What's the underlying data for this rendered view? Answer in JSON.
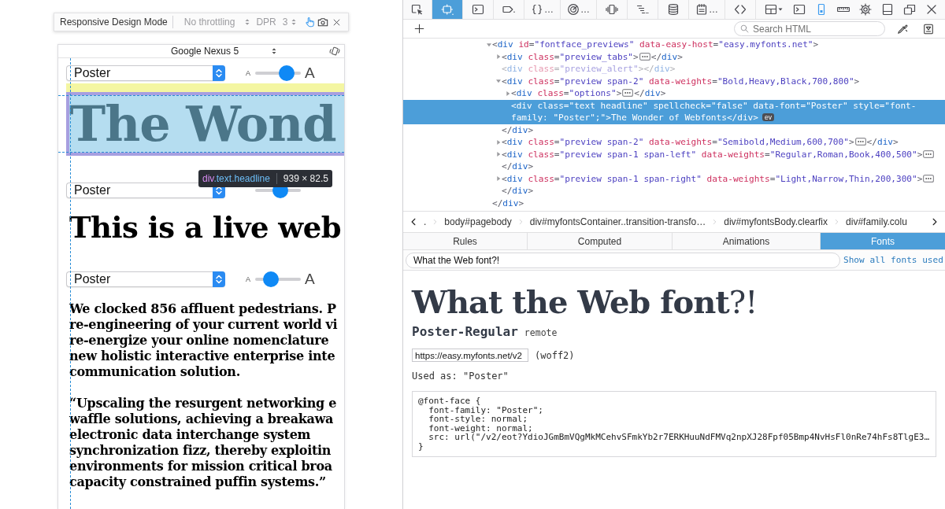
{
  "responsive_mode": {
    "toolbar": {
      "title": "Responsive Design Mode",
      "throttling": "No throttling",
      "dpr_label": "DPR",
      "dpr": "3",
      "touch_simulation": true
    },
    "viewport": {
      "device": "Google Nexus 5",
      "previews": [
        {
          "kind": "headline",
          "font": "Poster",
          "small_label": "A",
          "large_label": "A",
          "level": 0.79,
          "highlighted": true,
          "text": "The Wond"
        },
        {
          "kind": "title",
          "font": "Poster",
          "level": 0.58,
          "highlighted": false,
          "text": "This is a live web"
        },
        {
          "kind": "body",
          "font": "Poster",
          "small_label": "A",
          "large_label": "A",
          "level": 0.26,
          "highlighted": false,
          "paragraphs": [
            [
              "We clocked 856 affluent pedestrians. P",
              "re-engineering of your current world vi",
              "re-energize your online nomenclature",
              "new holistic interactive enterprise inte",
              "communication solution."
            ],
            [
              "“Upscaling the resurgent networking e",
              "waffle solutions, achieving a breakawa",
              "electronic data interchange system",
              "synchronization fizz, thereby exploitin",
              "environments for mission critical broa",
              "capacity constrained puffin systems.”"
            ]
          ]
        }
      ],
      "infobar": {
        "selector": "div.text.headline",
        "size": "939 × 82.5"
      }
    }
  },
  "devtools": {
    "tool_tabs": [
      {
        "selected": false
      },
      {
        "selected": true
      },
      {
        "selected": false
      },
      {
        "selected": false
      },
      {
        "selected": false,
        "label": "…"
      },
      {
        "selected": false,
        "label": "…"
      },
      {
        "selected": false
      },
      {
        "selected": false
      },
      {
        "selected": false
      },
      {
        "selected": false,
        "label": "…"
      },
      {
        "selected": false
      }
    ],
    "toolbar_buttons": [
      {
        "on": false
      },
      {
        "on": false
      },
      {
        "on": true
      },
      {
        "on": false
      },
      {
        "on": false
      },
      {
        "on": false
      },
      {
        "on": false
      },
      {
        "on": false
      }
    ],
    "search": {
      "placeholder": "Search HTML"
    },
    "markup": {
      "nodes": [
        {
          "kind": "container",
          "open_tag": "<div id=\"fontface_previews\" data-easy-host=\"easy.myfonts.net\">",
          "close_tag": "</div>",
          "expanded": true,
          "hidden": false,
          "selected": false,
          "children": [
            {
              "kind": "container",
              "open_tag": "<div class=\"preview_tabs\">",
              "close_tag": "</div>",
              "expanded": false,
              "hidden": false,
              "selected": false
            },
            {
              "kind": "leaf",
              "open_tag": "<div class=\"preview_alert\">",
              "close_tag": "</div>",
              "hidden": true,
              "selected": false
            },
            {
              "kind": "container",
              "open_tag": "<div class=\"preview span-2\" data-weights=\"Bold,Heavy,Black,700,800\">",
              "close_tag": "</div>",
              "expanded": true,
              "hidden": false,
              "selected": false,
              "children": [
                {
                  "kind": "container",
                  "open_tag": "<div class=\"options\">",
                  "close_tag": "</div>",
                  "expanded": false,
                  "hidden": false,
                  "selected": false
                },
                {
                  "kind": "leaf",
                  "open_tag": "<div class=\"text headline\" spellcheck=\"false\" data-font=\"Poster\" style=\"font-family: \"Poster\";\">",
                  "text": "The Wonder of Webfonts",
                  "close_tag": "</div>",
                  "badge": "ev",
                  "hidden": false,
                  "selected": true
                }
              ]
            },
            {
              "kind": "container",
              "open_tag": "<div class=\"preview span-2\" data-weights=\"Semibold,Medium,600,700\">",
              "close_tag": "</div>",
              "expanded": false,
              "hidden": false,
              "selected": false
            },
            {
              "kind": "container",
              "open_tag": "<div class=\"preview span-1 span-left\" data-weights=\"Regular,Roman,Book,400,500\">",
              "close_tag": "</div>",
              "expanded": false,
              "hidden": false,
              "selected": false
            },
            {
              "kind": "container",
              "open_tag": "<div class=\"preview span-1 span-right\" data-weights=\"Light,Narrow,Thin,200,300\">",
              "close_tag": "</div>",
              "expanded": false,
              "hidden": false,
              "selected": false
            }
          ]
        }
      ]
    },
    "breadcrumbs": [
      ".",
      "body#pagebody",
      "div#myfontsContainer..transition-transfo…",
      "div#myfontsBody.clearfix",
      "div#family.colu"
    ],
    "sidebar_tabs": [
      {
        "label": "Rules",
        "selected": false
      },
      {
        "label": "Computed",
        "selected": false
      },
      {
        "label": "Animations",
        "selected": false
      },
      {
        "label": "Fonts",
        "selected": true
      }
    ],
    "fonts": {
      "filter": "What the Web font?!",
      "show_all": "Show all fonts used",
      "preview": "**What the Web font**?!",
      "name": "Poster-Regular",
      "origin": "remote",
      "url": "https://easy.myfonts.net/v2",
      "format": "(woff2)",
      "used_as": "Used as: \"Poster\"",
      "rule": [
        "@font-face {",
        "  font-family: \"Poster\";",
        "  font-style: normal;",
        "  font-weight: normal;",
        "  src: url(\"/v2/eot?YdioJGmBmVQgMkMCehvSFmkYb2r7ERKHuuNdFMVq2npXJ28Fpf05Bmp4NvHsFl0nRe74hFs8TlgE3…",
        "}"
      ]
    }
  }
}
